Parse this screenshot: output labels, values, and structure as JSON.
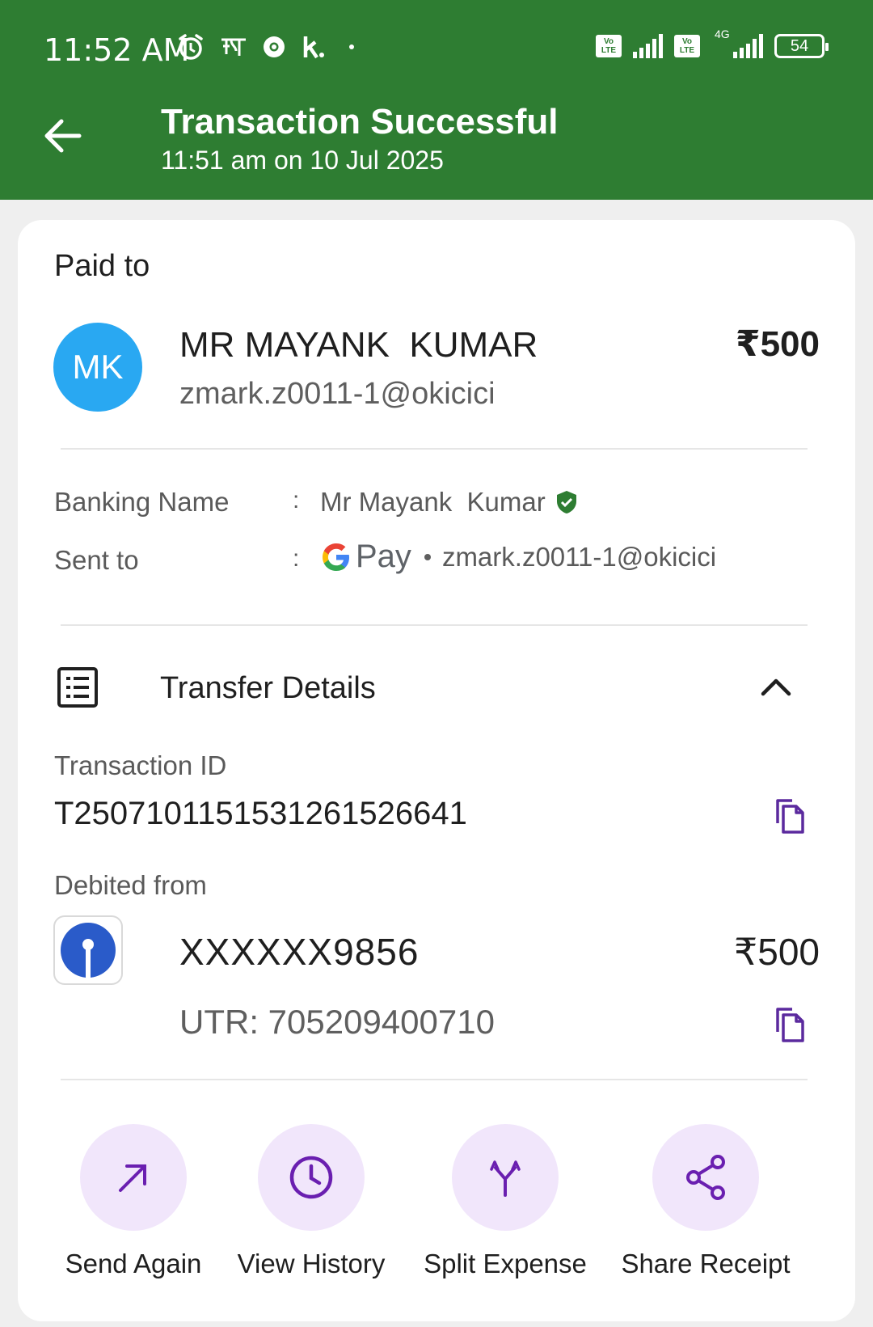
{
  "status_bar": {
    "time": "11:52 AM",
    "network_type": "4G",
    "battery": "54",
    "volte_label_top": "Vo",
    "volte_label_bottom": "LTE"
  },
  "header": {
    "title": "Transaction Successful",
    "subtitle": "11:51 am on 10 Jul 2025",
    "back_icon": "arrow-left-icon"
  },
  "colors": {
    "header_bg": "#2e7d32",
    "avatar_bg": "#29a8f2",
    "action_circle_bg": "#f1e6fb",
    "action_icon": "#6a1fb0",
    "verified": "#2e7d32"
  },
  "payee": {
    "section_label": "Paid to",
    "initials": "MK",
    "name": "MR MAYANK  KUMAR",
    "vpa": "zmark.z0011-1@okicici",
    "amount": "₹500"
  },
  "details": {
    "banking_name_label": "Banking Name",
    "banking_name_value": "Mr Mayank  Kumar",
    "sent_to_label": "Sent to",
    "sent_to_app": "Pay",
    "sent_to_vpa": "zmark.z0011-1@okicici",
    "separator": ":"
  },
  "transfer": {
    "section_title": "Transfer Details",
    "txn_id_label": "Transaction ID",
    "txn_id": "T2507101151531261526641",
    "debited_from_label": "Debited from",
    "account": "XXXXXX9856",
    "amount": "₹500",
    "utr": "UTR: 705209400710"
  },
  "actions": [
    {
      "label": "Send Again",
      "icon": "arrow-up-right-icon"
    },
    {
      "label": "View History",
      "icon": "clock-icon"
    },
    {
      "label": "Split Expense",
      "icon": "split-icon"
    },
    {
      "label": "Share Receipt",
      "icon": "share-icon"
    }
  ]
}
